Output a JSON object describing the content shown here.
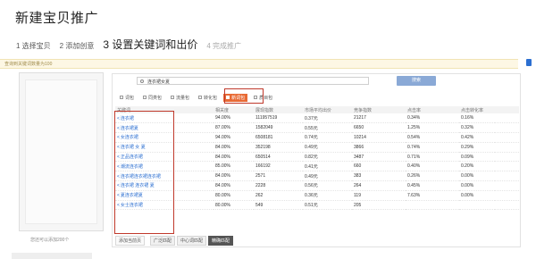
{
  "page": {
    "title": "新建宝贝推广"
  },
  "steps": [
    {
      "label": "1 选择宝贝"
    },
    {
      "label": "2 添加创意"
    },
    {
      "label": "3 设置关键词和出价"
    },
    {
      "label": "4 完成推广"
    }
  ],
  "notice": {
    "text": "查询到关键词数量为100"
  },
  "left_panel": {
    "count_text": "您还可以添加200个"
  },
  "search": {
    "value": "连衣裙女夏",
    "button_label": "搜索"
  },
  "filters": {
    "tabs": [
      {
        "label": "词包"
      },
      {
        "label": "同类包"
      },
      {
        "label": "流量包"
      },
      {
        "label": "转化包"
      },
      {
        "label": "新词包",
        "active": true
      },
      {
        "label": "质目包"
      }
    ]
  },
  "table": {
    "headers": [
      "关键词",
      "相关度",
      "展现指数",
      "市场平均出价",
      "竞争指数",
      "点击率",
      "点击转化率"
    ],
    "rows": [
      {
        "keyword": "连衣裙",
        "relevance": "94.00%",
        "impressions": "111957519",
        "avg_bid": "0.37元",
        "competition": "21217",
        "ctr": "0.34%",
        "cvr": "0.16%"
      },
      {
        "keyword": "连衣裙夏",
        "relevance": "87.00%",
        "impressions": "1582049",
        "avg_bid": "0.55元",
        "competition": "6650",
        "ctr": "1.25%",
        "cvr": "0.32%"
      },
      {
        "keyword": "女连衣裙",
        "relevance": "94.00%",
        "impressions": "6508181",
        "avg_bid": "0.74元",
        "competition": "10214",
        "ctr": "0.54%",
        "cvr": "0.42%"
      },
      {
        "keyword": "连衣裙 女 夏",
        "relevance": "84.00%",
        "impressions": "352198",
        "avg_bid": "0.49元",
        "competition": "3866",
        "ctr": "0.74%",
        "cvr": "0.29%"
      },
      {
        "keyword": "正品连衣裙",
        "relevance": "84.00%",
        "impressions": "650514",
        "avg_bid": "0.82元",
        "competition": "3487",
        "ctr": "0.71%",
        "cvr": "0.09%"
      },
      {
        "keyword": "潮流连衣裙",
        "relevance": "85.00%",
        "impressions": "166192",
        "avg_bid": "0.41元",
        "competition": "660",
        "ctr": "0.40%",
        "cvr": "0.20%"
      },
      {
        "keyword": "连衣裙连衣裙连衣裙",
        "relevance": "84.00%",
        "impressions": "2571",
        "avg_bid": "0.49元",
        "competition": "383",
        "ctr": "0.26%",
        "cvr": "0.00%"
      },
      {
        "keyword": "连衣裙 连衣裙 夏",
        "relevance": "84.00%",
        "impressions": "2228",
        "avg_bid": "0.56元",
        "competition": "264",
        "ctr": "0.45%",
        "cvr": "0.00%"
      },
      {
        "keyword": "夏连衣裙夏",
        "relevance": "80.00%",
        "impressions": "262",
        "avg_bid": "0.36元",
        "competition": "119",
        "ctr": "7.63%",
        "cvr": "0.00%"
      },
      {
        "keyword": "女士连衣裙",
        "relevance": "80.00%",
        "impressions": "549",
        "avg_bid": "0.51元",
        "competition": "205",
        "ctr": "",
        "cvr": ""
      }
    ]
  },
  "bottom": {
    "add_all_label": "添加当前页",
    "match_buttons": [
      {
        "label": "广泛匹配"
      },
      {
        "label": "中心词匹配"
      },
      {
        "label": "精确匹配",
        "active": true
      }
    ]
  },
  "colors": {
    "accent": "#e86a34",
    "highlight_border": "#c0392b",
    "link": "#2c6fd1",
    "search_button": "#8aa9d6"
  }
}
